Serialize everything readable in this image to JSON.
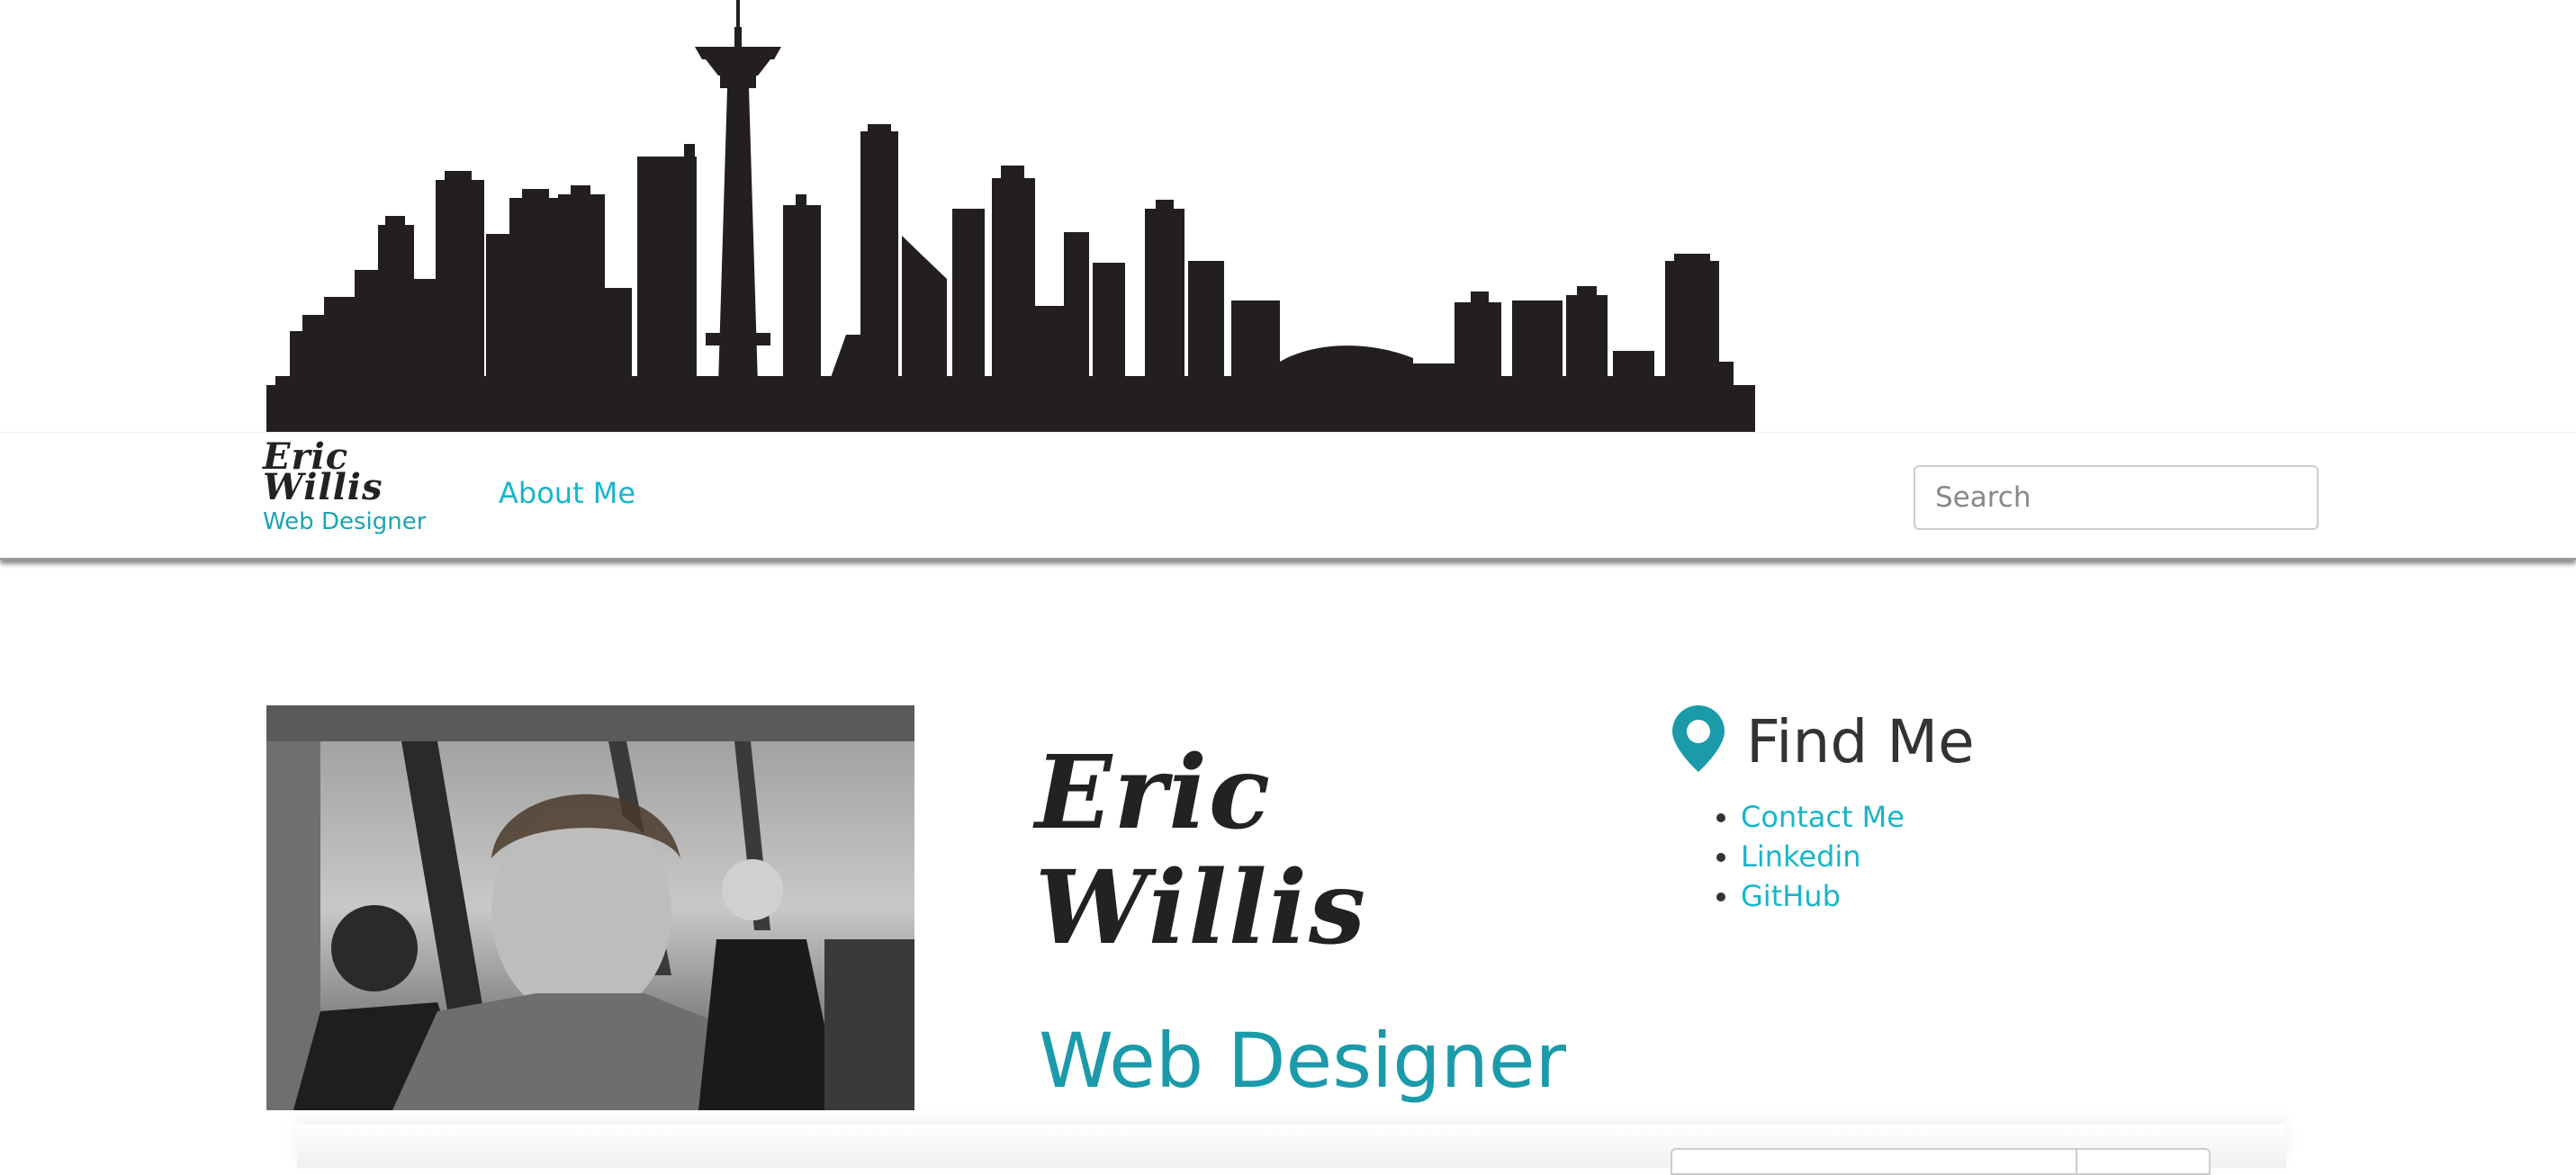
{
  "header": {
    "skyline_image": "seattle-skyline-silhouette"
  },
  "navbar": {
    "brand_name": "Eric Willis",
    "brand_subtitle": "Web Designer",
    "nav_link": "About Me",
    "search_placeholder": "Search"
  },
  "profile": {
    "photo": "profile-photo",
    "name": "Eric Willis",
    "title": "Web Designer"
  },
  "find_me": {
    "icon": "map-pin-icon",
    "heading": "Find Me",
    "links": [
      "Contact Me",
      "Linkedin",
      "GitHub"
    ]
  },
  "colors": {
    "accent": "#19b5c9",
    "title_teal": "#1b9aaa",
    "dark_text": "#222222",
    "skyline": "#231f20"
  }
}
